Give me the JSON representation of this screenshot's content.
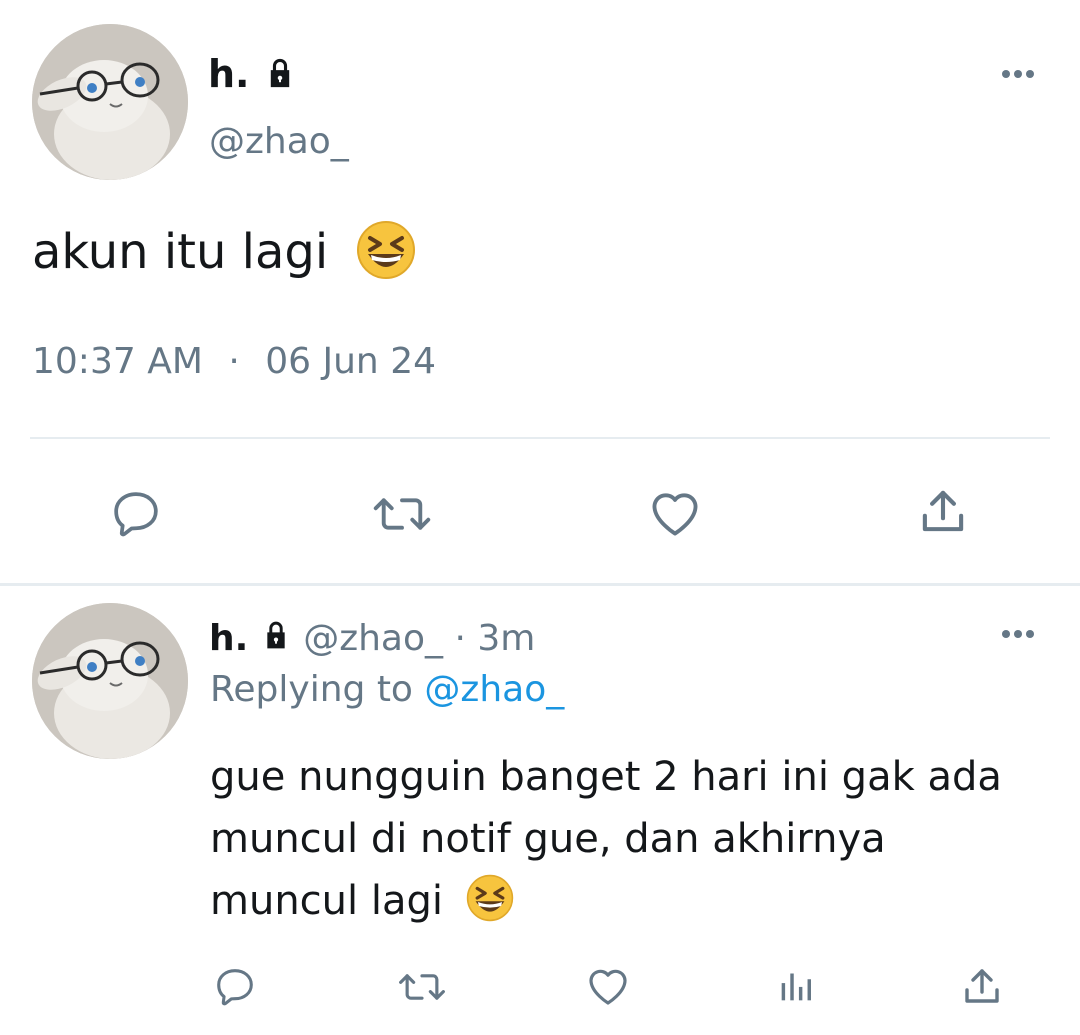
{
  "main_tweet": {
    "display_name": "h.",
    "handle": "@zhao_",
    "text": "akun itu lagi",
    "emoji": "grinning-squinting-face",
    "time": "10:37 AM",
    "separator": "·",
    "date": "06 Jun 24"
  },
  "reply": {
    "display_name": "h.",
    "handle": "@zhao_",
    "age": "· 3m",
    "replying_prefix": "Replying to",
    "replying_handle": "@zhao_",
    "text_line1": "gue nungguin banget 2 hari ini gak ada",
    "text_line2": "muncul di notif gue, dan akhirnya",
    "text_line3": "muncul lagi",
    "emoji": "grinning-squinting-face"
  },
  "colors": {
    "text": "#14171a",
    "muted": "#657786",
    "link": "#1b95e0",
    "divider": "#e6ecf0"
  },
  "icons": [
    "more-icon",
    "lock-icon",
    "reply-icon",
    "retweet-icon",
    "like-icon",
    "share-icon",
    "analytics-icon"
  ]
}
